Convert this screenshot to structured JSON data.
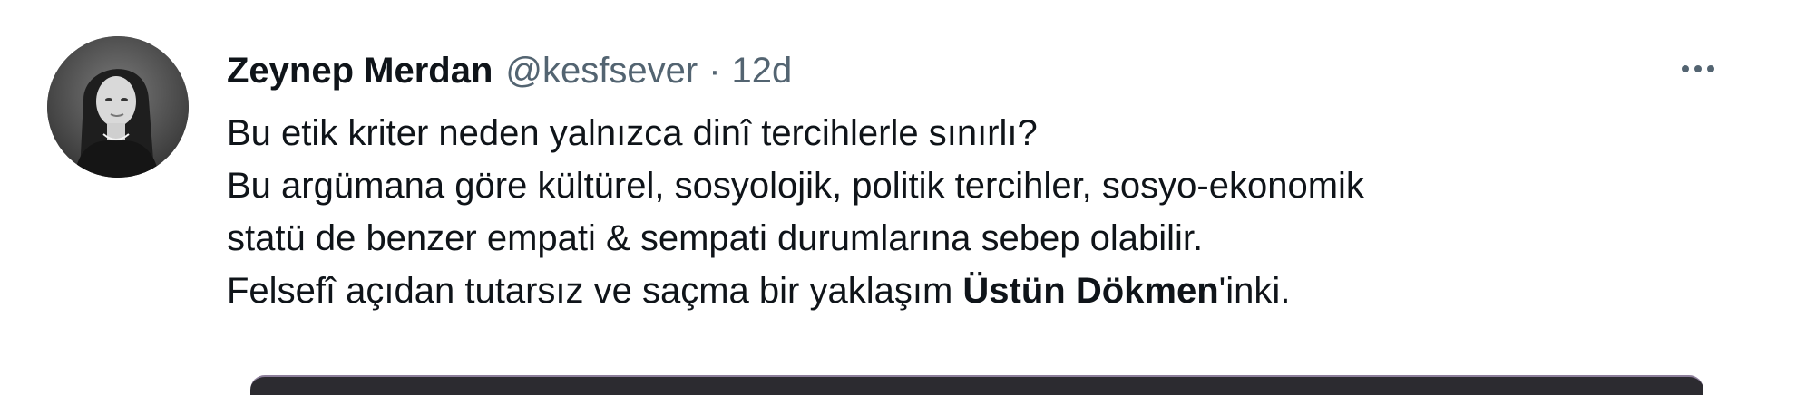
{
  "tweet": {
    "author": {
      "display_name": "Zeynep Merdan",
      "handle": "@kesfsever",
      "avatar_icon": "profile-photo"
    },
    "separator": "·",
    "timestamp": "12d",
    "more_icon": "more-horizontal-icon",
    "body": {
      "line1": "Bu etik kriter neden yalnızca dinî tercihlerle sınırlı?",
      "line2": "Bu argümana göre kültürel, sosyolojik, politik tercihler, sosyo-ekonomik",
      "line3": "statü de benzer empati & sempati durumlarına sebep olabilir.",
      "line4_prefix": "Felsefî açıdan tutarsız ve saçma bir yaklaşım ",
      "line4_mention": "Üstün Dökmen",
      "line4_suffix": "'inki."
    }
  },
  "colors": {
    "text_primary": "#0f1419",
    "text_secondary": "#536471",
    "background": "#ffffff"
  }
}
